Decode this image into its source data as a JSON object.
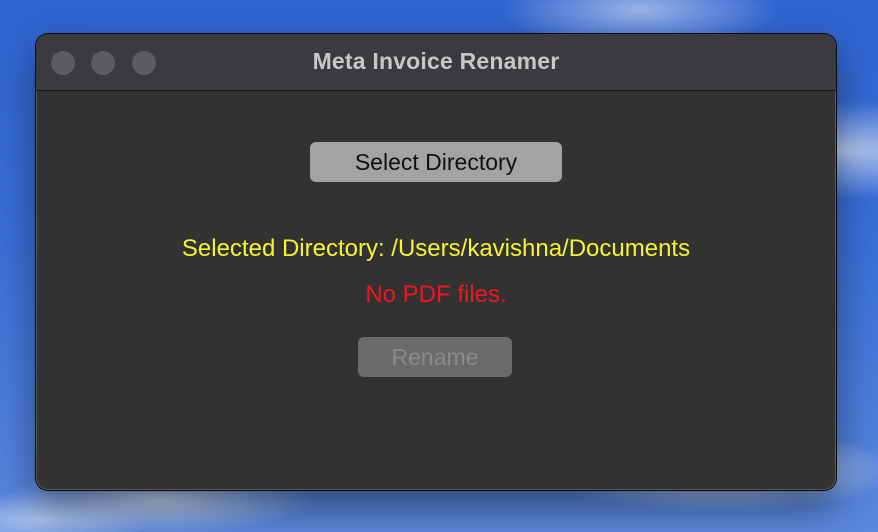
{
  "window": {
    "title": "Meta Invoice Renamer"
  },
  "main": {
    "select_button_label": "Select Directory",
    "selected_directory_text": "Selected Directory: /Users/kavishna/Documents",
    "status_text": "No PDF files.",
    "rename_button_label": "Rename",
    "rename_button_enabled": false
  },
  "colors": {
    "window_background": "#323232",
    "selected_directory_text": "#f5f52e",
    "status_error_text": "#f2151f",
    "button_background": "#a3a3a3",
    "disabled_button_background": "#6a6a6a"
  }
}
